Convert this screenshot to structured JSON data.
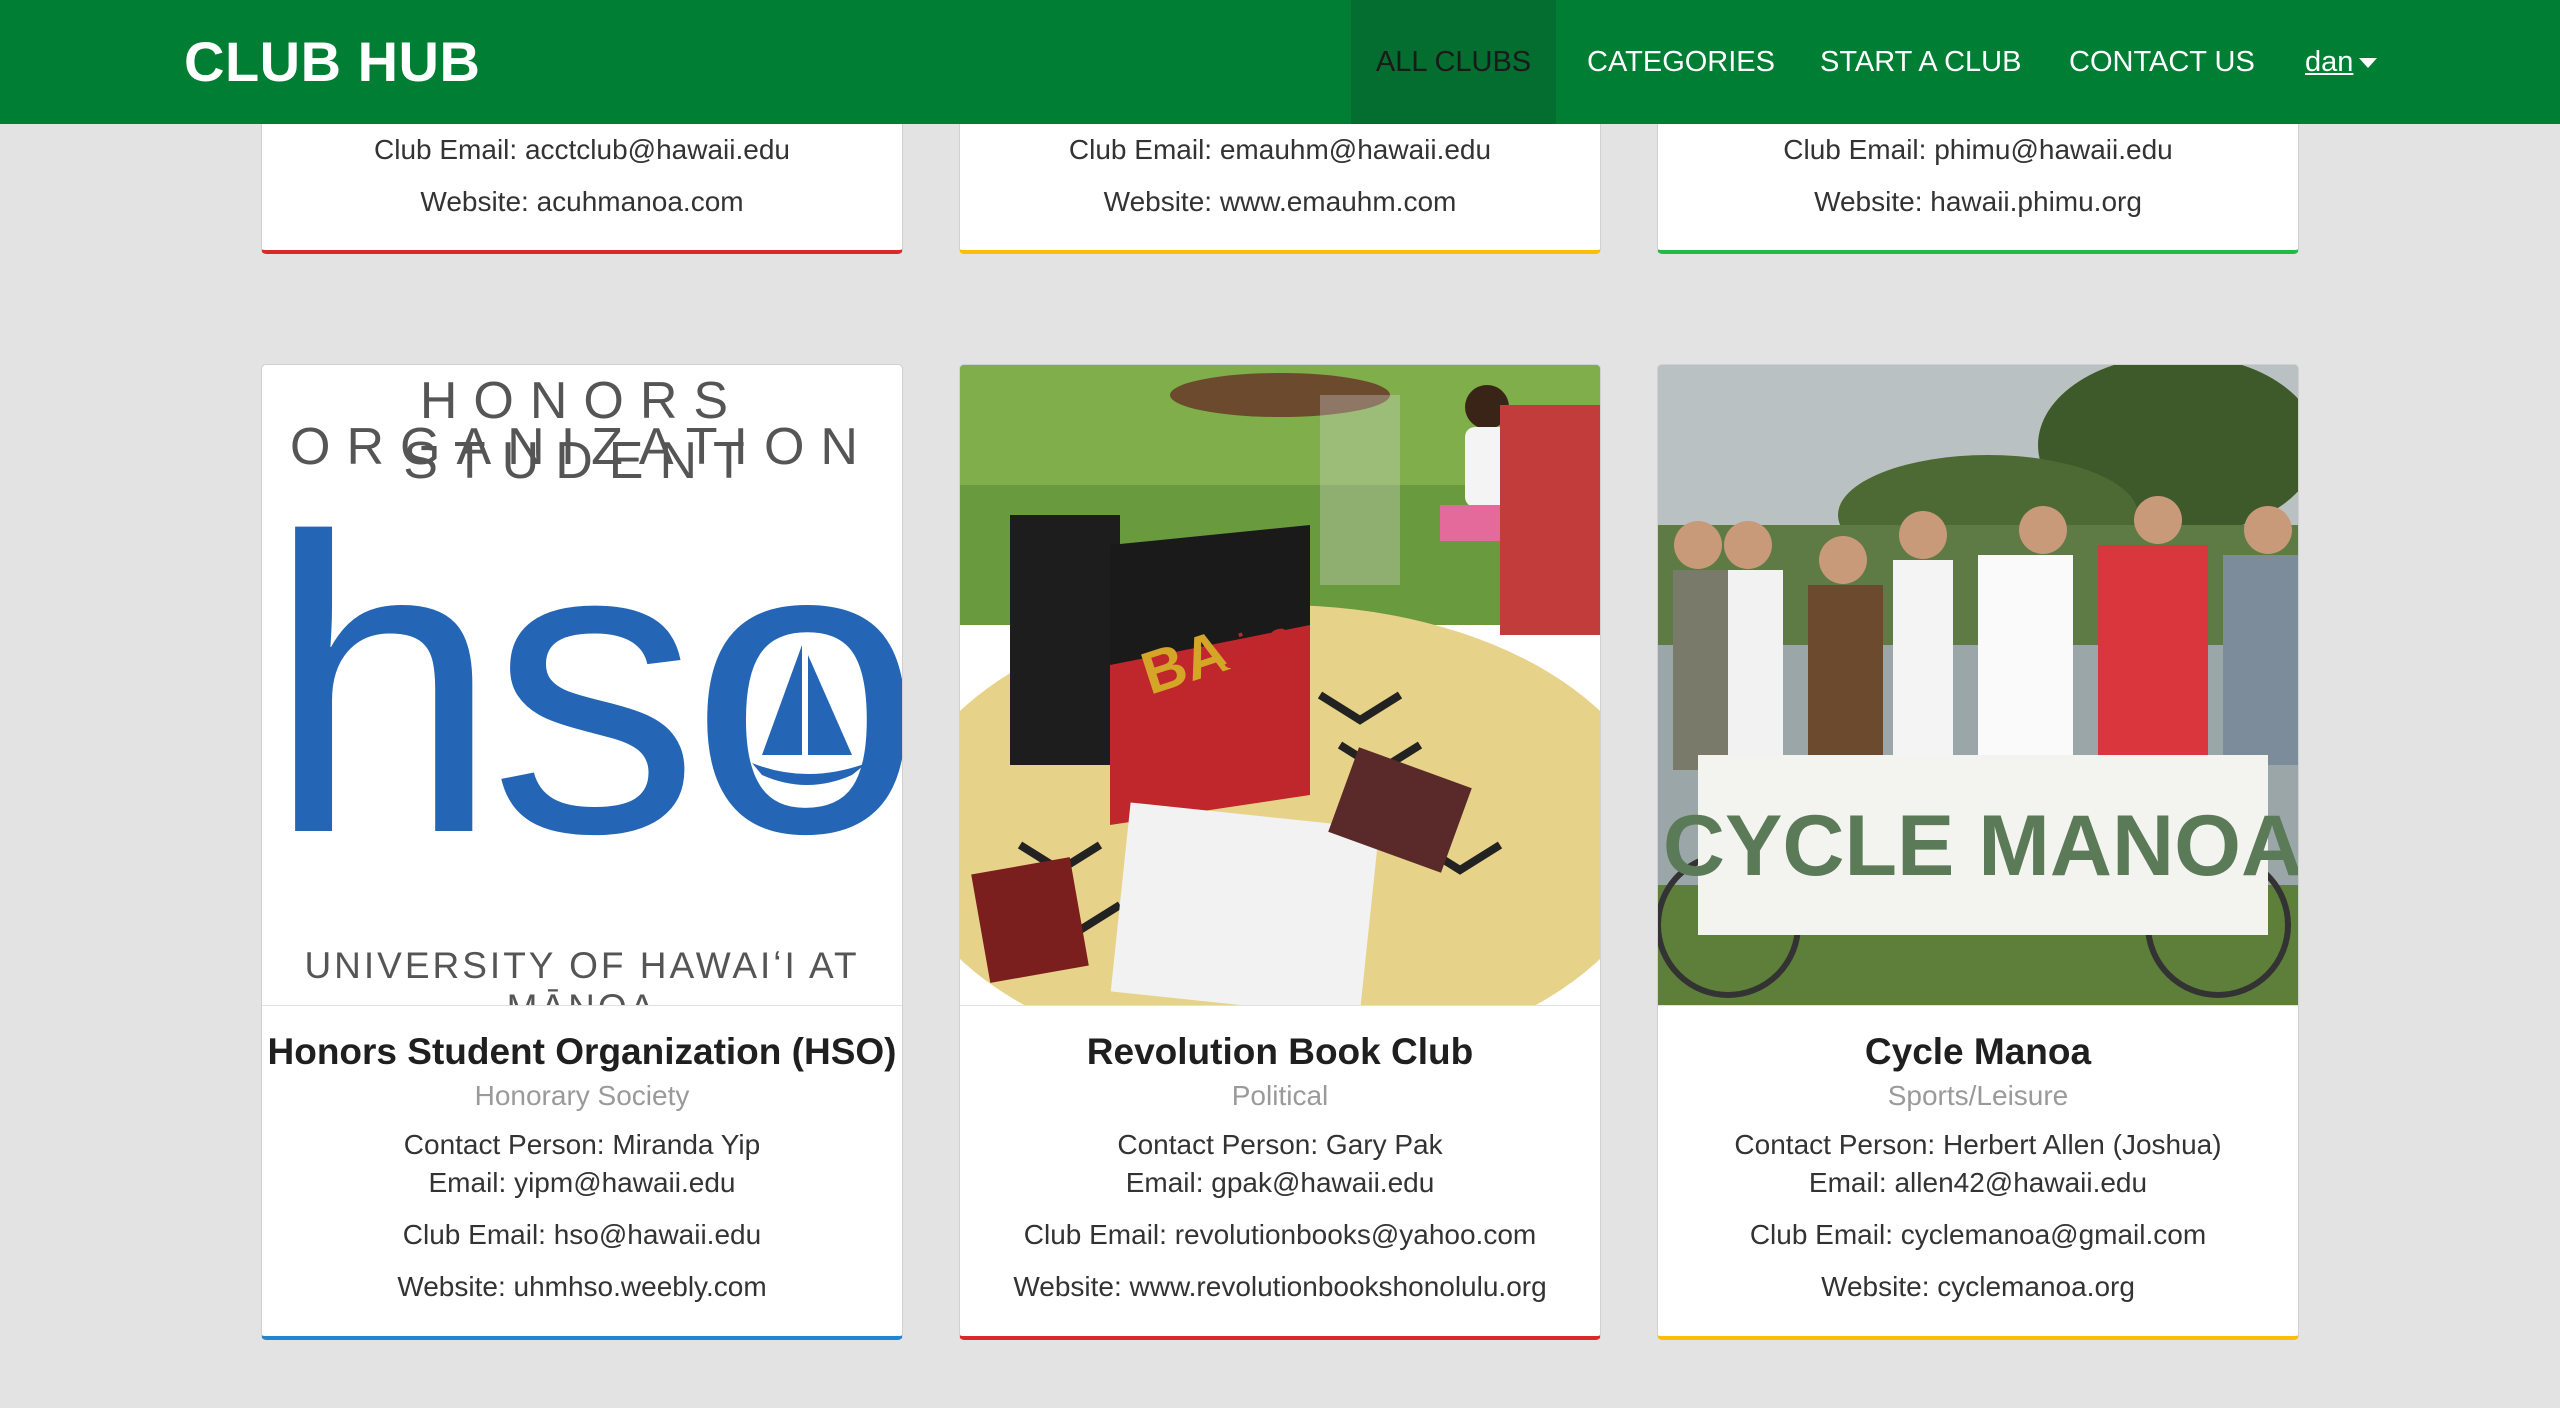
{
  "navbar": {
    "brand": "CLUB HUB",
    "items": [
      {
        "label": "ALL CLUBS",
        "active": true
      },
      {
        "label": "CATEGORIES"
      },
      {
        "label": "START A CLUB"
      },
      {
        "label": "CONTACT US"
      }
    ],
    "user": "dan"
  },
  "top_cards": [
    {
      "club_email": "Club Email: acctclub@hawaii.edu",
      "website": "Website: acuhmanoa.com",
      "accent": "#db2828"
    },
    {
      "club_email": "Club Email: emauhm@hawaii.edu",
      "website": "Website: www.emauhm.com",
      "accent": "#fbbd08"
    },
    {
      "club_email": "Club Email: phimu@hawaii.edu",
      "website": "Website: hawaii.phimu.org",
      "accent": "#21ba45"
    }
  ],
  "cards": [
    {
      "image_logo": {
        "line1": "HONORS STUDENT",
        "line2": "ORGANIZATION",
        "big": "hso",
        "footer": "UNIVERSITY OF HAWAIʻI AT MĀNOA"
      },
      "name": "Honors Student Organization (HSO)",
      "category": "Honorary Society",
      "contact": "Contact Person: Miranda Yip",
      "email": "Email: yipm@hawaii.edu",
      "club_email": "Club Email: hso@hawaii.edu",
      "website": "Website: uhmhso.weebly.com",
      "accent": "#2185d0"
    },
    {
      "name": "Revolution Book Club",
      "category": "Political",
      "contact": "Contact Person: Gary Pak",
      "email": "Email: gpak@hawaii.edu",
      "club_email": "Club Email: revolutionbooks@yahoo.com",
      "website": "Website: www.revolutionbookshonolulu.org",
      "accent": "#db2828"
    },
    {
      "banner_text": "CYCLE MANOA",
      "name": "Cycle Manoa",
      "category": "Sports/Leisure",
      "contact": "Contact Person: Herbert Allen (Joshua)",
      "email": "Email: allen42@hawaii.edu",
      "club_email": "Club Email: cyclemanoa@gmail.com",
      "website": "Website: cyclemanoa.org",
      "accent": "#fbbd08"
    }
  ]
}
